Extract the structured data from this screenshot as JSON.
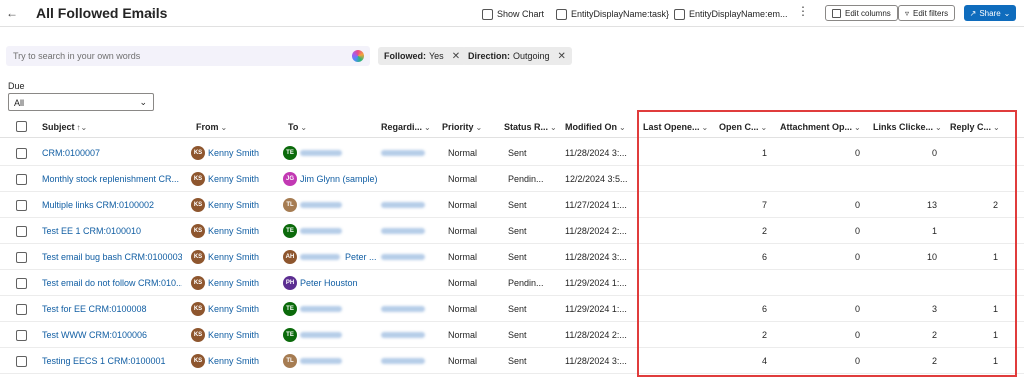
{
  "header": {
    "title": "All Followed Emails",
    "commands": {
      "show_chart": "Show Chart",
      "task_name": "EntityDisplayName:task}",
      "email_name": "EntityDisplayName:em...",
      "edit_columns": "Edit columns",
      "edit_filters": "Edit filters",
      "share": "Share"
    }
  },
  "search": {
    "placeholder": "Try to search in your own words"
  },
  "filters": [
    {
      "key": "Followed:",
      "value": "Yes"
    },
    {
      "key": "Direction:",
      "value": "Outgoing"
    }
  ],
  "due": {
    "label": "Due",
    "value": "All"
  },
  "columns": {
    "subject": "Subject",
    "from": "From",
    "to": "To",
    "regarding": "Regardi...",
    "priority": "Priority",
    "status_reason": "Status R...",
    "modified_on": "Modified On",
    "last_opened": "Last Opene...",
    "open_count": "Open C...",
    "attachment_opened": "Attachment Op...",
    "links_clicked": "Links Clicke...",
    "reply_count": "Reply C..."
  },
  "rows": [
    {
      "subject": "CRM:0100007",
      "from": "Kenny Smith",
      "from_initials": "KS",
      "to": "",
      "to_initials": "TE",
      "to_color": "#0b6a0b",
      "priority": "Normal",
      "status": "Sent",
      "modified": "11/28/2024 3:...",
      "open_count": "1",
      "attachment": "0",
      "links": "0",
      "reply": ""
    },
    {
      "subject": "Monthly stock replenishment CR...",
      "from": "Kenny Smith",
      "from_initials": "KS",
      "to": "Jim Glynn (sample)",
      "to_initials": "JG",
      "to_color": "#c239b3",
      "priority": "Normal",
      "status": "Pendin...",
      "modified": "12/2/2024 3:5...",
      "open_count": "",
      "attachment": "",
      "links": "",
      "reply": ""
    },
    {
      "subject": "Multiple links CRM:0100002",
      "from": "Kenny Smith",
      "from_initials": "KS",
      "to": "",
      "to_initials": "TL",
      "to_color": "#a67c52",
      "priority": "Normal",
      "status": "Sent",
      "modified": "11/27/2024 1:...",
      "open_count": "7",
      "attachment": "0",
      "links": "13",
      "reply": "2"
    },
    {
      "subject": "Test EE 1 CRM:0100010",
      "from": "Kenny Smith",
      "from_initials": "KS",
      "to": "",
      "to_initials": "TE",
      "to_color": "#0b6a0b",
      "priority": "Normal",
      "status": "Sent",
      "modified": "11/28/2024 2:...",
      "open_count": "2",
      "attachment": "0",
      "links": "1",
      "reply": ""
    },
    {
      "subject": "Test email bug bash CRM:0100003",
      "from": "Kenny Smith",
      "from_initials": "KS",
      "to": "Peter ...",
      "to_initials": "AH",
      "to_color": "#8e562e",
      "priority": "Normal",
      "status": "Sent",
      "modified": "11/28/2024 3:...",
      "open_count": "6",
      "attachment": "0",
      "links": "10",
      "reply": "1"
    },
    {
      "subject": "Test email do not follow CRM:010...",
      "from": "Kenny Smith",
      "from_initials": "KS",
      "to": "Peter Houston",
      "to_initials": "PH",
      "to_color": "#5c2e91",
      "priority": "Normal",
      "status": "Pendin...",
      "modified": "11/29/2024 1:...",
      "open_count": "",
      "attachment": "",
      "links": "",
      "reply": ""
    },
    {
      "subject": "Test for EE CRM:0100008",
      "from": "Kenny Smith",
      "from_initials": "KS",
      "to": "",
      "to_initials": "TE",
      "to_color": "#0b6a0b",
      "priority": "Normal",
      "status": "Sent",
      "modified": "11/29/2024 1:...",
      "open_count": "6",
      "attachment": "0",
      "links": "3",
      "reply": "1"
    },
    {
      "subject": "Test WWW CRM:0100006",
      "from": "Kenny Smith",
      "from_initials": "KS",
      "to": "",
      "to_initials": "TE",
      "to_color": "#0b6a0b",
      "priority": "Normal",
      "status": "Sent",
      "modified": "11/28/2024 2:...",
      "open_count": "2",
      "attachment": "0",
      "links": "2",
      "reply": "1"
    },
    {
      "subject": "Testing EECS 1 CRM:0100001",
      "from": "Kenny Smith",
      "from_initials": "KS",
      "to": "",
      "to_initials": "TL",
      "to_color": "#a67c52",
      "priority": "Normal",
      "status": "Sent",
      "modified": "11/28/2024 3:...",
      "open_count": "4",
      "attachment": "0",
      "links": "2",
      "reply": "1"
    }
  ],
  "colors": {
    "accent": "#0f6cbd",
    "highlight": "#e03c3c",
    "avatar_from": "#8e562e"
  }
}
